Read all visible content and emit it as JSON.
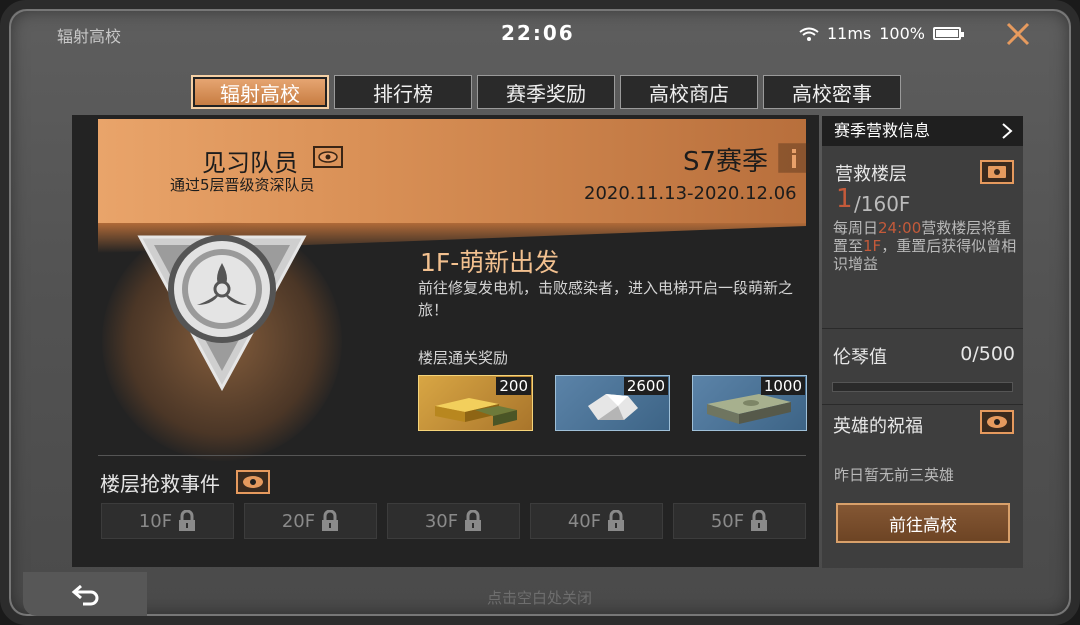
{
  "status_bar": {
    "app_name": "辐射高校",
    "time": "22:06",
    "ping": "11ms",
    "battery": "100%"
  },
  "tabs": [
    {
      "label": "辐射高校",
      "active": true
    },
    {
      "label": "排行榜",
      "active": false
    },
    {
      "label": "赛季奖励",
      "active": false
    },
    {
      "label": "高校商店",
      "active": false
    },
    {
      "label": "高校密事",
      "active": false
    }
  ],
  "banner": {
    "rank_title": "见习队员",
    "rank_subtitle": "通过5层晋级资深队员",
    "season": "S7赛季",
    "dates": "2020.11.13-2020.12.06"
  },
  "floor": {
    "title": "1F-萌新出发",
    "description": "前往修复发电机，击败感染者，进入电梯开启一段萌新之旅！",
    "reward_label": "楼层通关奖励",
    "rewards": [
      {
        "count": "200",
        "icon": "gold-bars-icon"
      },
      {
        "count": "2600",
        "icon": "silver-ore-icon"
      },
      {
        "count": "1000",
        "icon": "cash-stack-icon"
      }
    ]
  },
  "rescue": {
    "title": "楼层抢救事件",
    "floors": [
      "10F",
      "20F",
      "30F",
      "40F",
      "50F"
    ]
  },
  "side": {
    "header": "赛季营救信息",
    "rescue_floor_label": "营救楼层",
    "current_floor": "1",
    "total_floor": "/160F",
    "reset_prefix": "每周日",
    "reset_time": "24:00",
    "reset_mid": "营救楼层将重置至",
    "reset_floor": "1F",
    "reset_suffix": "，重置后获得似曾相识增益",
    "lunqin_label": "伦琴值",
    "lunqin_value": "0/500",
    "lunqin_fraction": 0,
    "hero_label": "英雄的祝福",
    "hero_note": "昨日暂无前三英雄",
    "go_button": "前往高校"
  },
  "bottom": {
    "close_hint": "点击空白处关闭"
  },
  "colors": {
    "accent": "#d88f55",
    "highlight_red": "#c45a3a",
    "floor_title": "#f2c08f"
  }
}
